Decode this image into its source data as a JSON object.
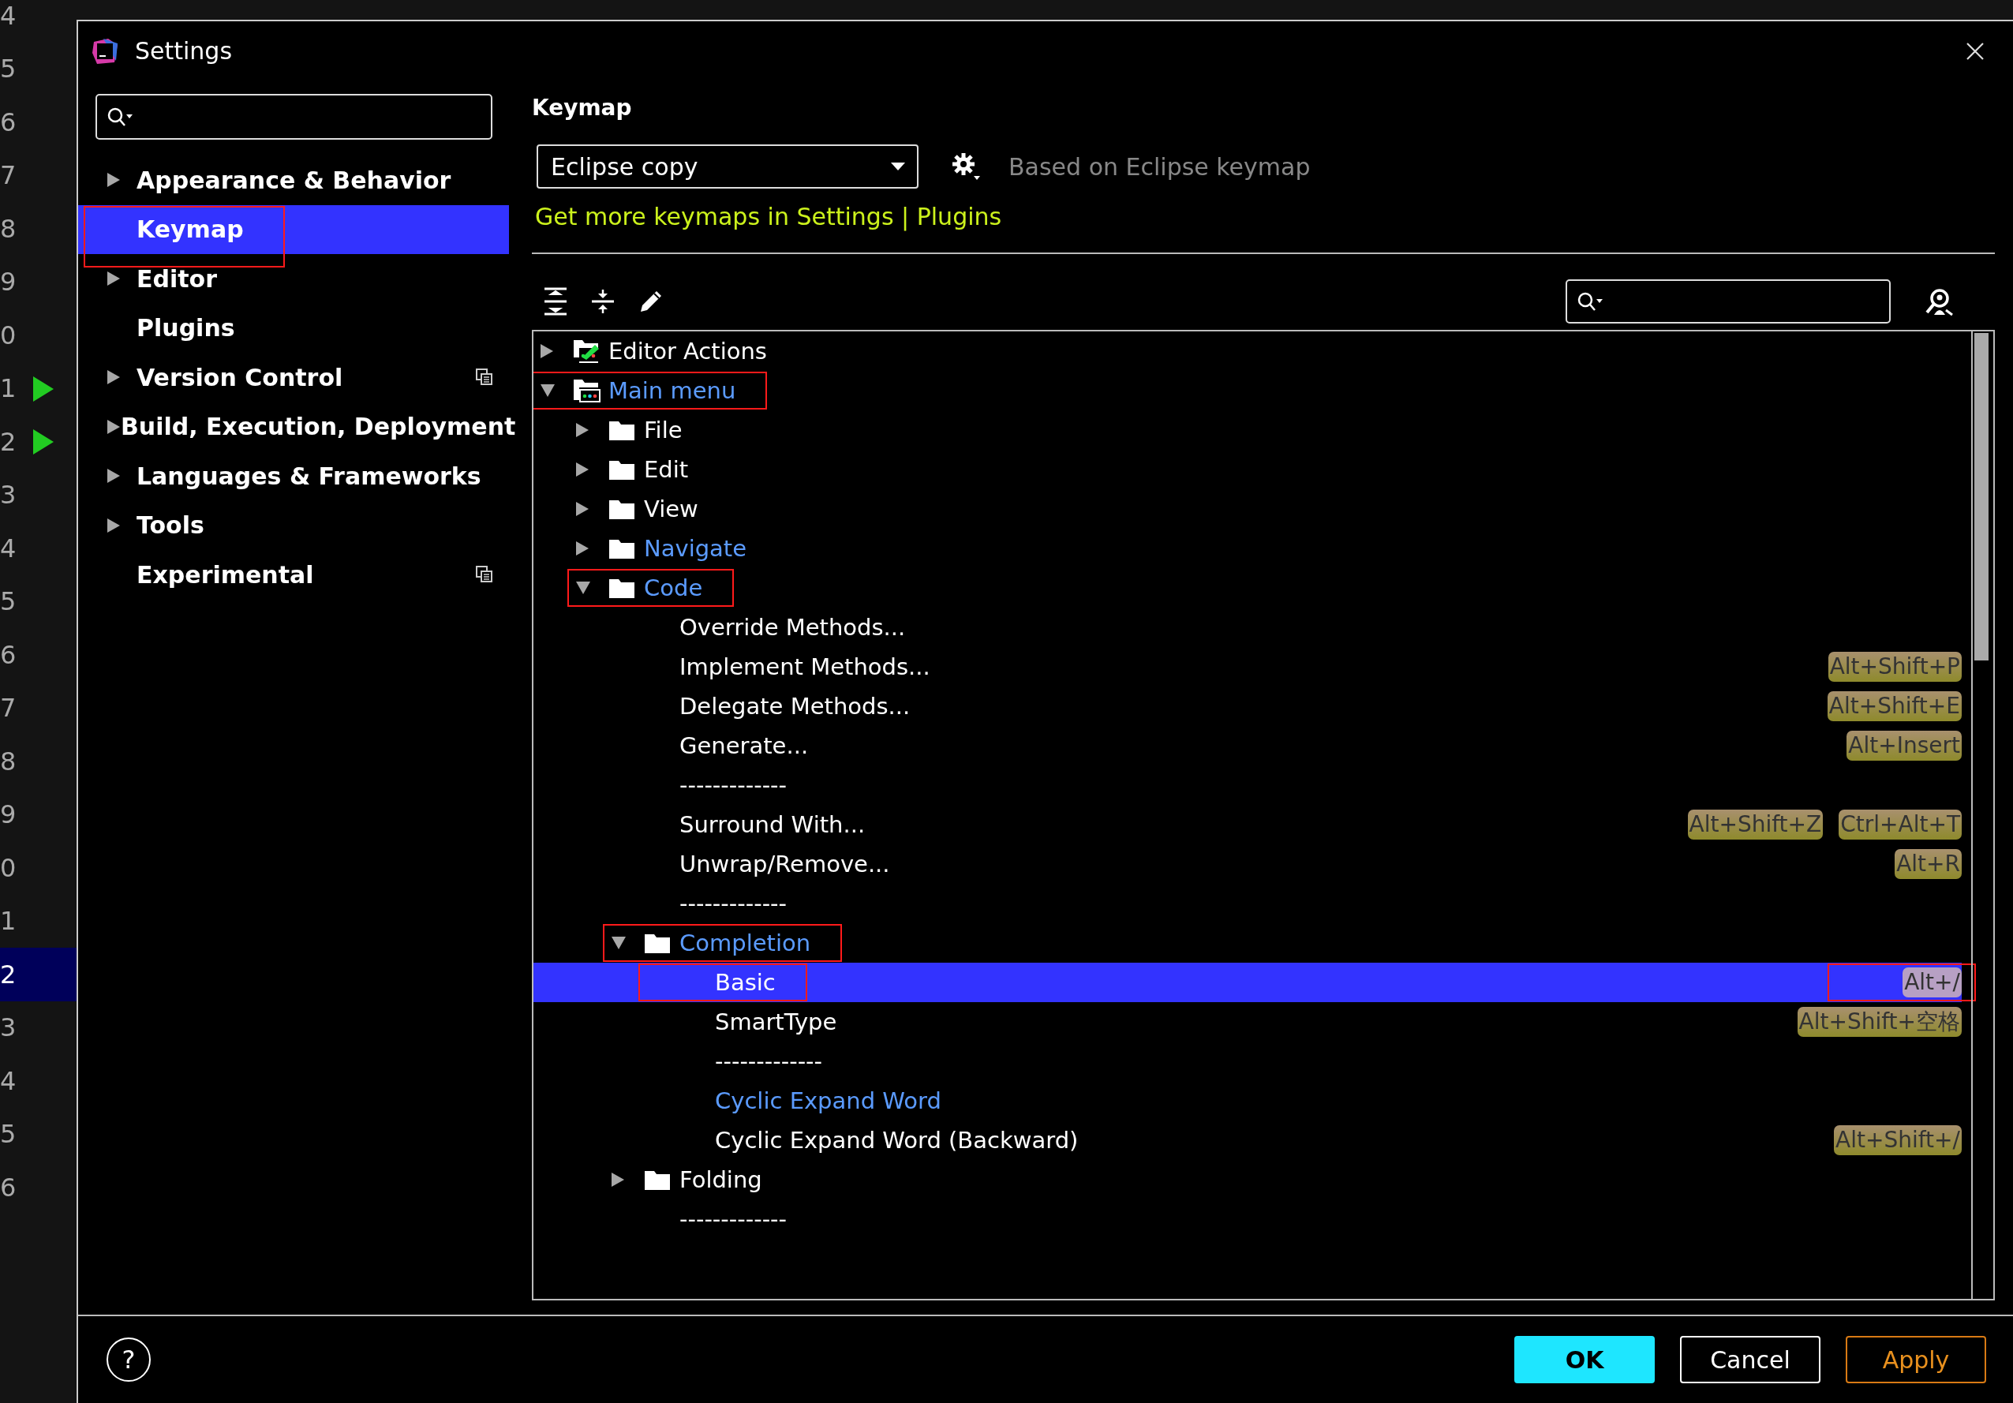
{
  "editor_gutter": {
    "lines": [
      {
        "number": "4",
        "run": false,
        "selected": false
      },
      {
        "number": "5",
        "run": false,
        "selected": false
      },
      {
        "number": "6",
        "run": false,
        "selected": false
      },
      {
        "number": "7",
        "run": false,
        "selected": false
      },
      {
        "number": "8",
        "run": false,
        "selected": false
      },
      {
        "number": "9",
        "run": false,
        "selected": false
      },
      {
        "number": "0",
        "run": false,
        "selected": false
      },
      {
        "number": "1",
        "run": true,
        "selected": false
      },
      {
        "number": "2",
        "run": true,
        "selected": false
      },
      {
        "number": "3",
        "run": false,
        "selected": false
      },
      {
        "number": "4",
        "run": false,
        "selected": false
      },
      {
        "number": "5",
        "run": false,
        "selected": false
      },
      {
        "number": "6",
        "run": false,
        "selected": false
      },
      {
        "number": "7",
        "run": false,
        "selected": false
      },
      {
        "number": "8",
        "run": false,
        "selected": false
      },
      {
        "number": "9",
        "run": false,
        "selected": false
      },
      {
        "number": "0",
        "run": false,
        "selected": false
      },
      {
        "number": "1",
        "run": false,
        "selected": false
      },
      {
        "number": "2",
        "run": false,
        "selected": true
      },
      {
        "number": "3",
        "run": false,
        "selected": false
      },
      {
        "number": "4",
        "run": false,
        "selected": false
      },
      {
        "number": "5",
        "run": false,
        "selected": false
      },
      {
        "number": "6",
        "run": false,
        "selected": false
      }
    ]
  },
  "window": {
    "title": "Settings"
  },
  "sidebar": {
    "items": [
      {
        "label": "Appearance & Behavior",
        "expandable": true,
        "selected": false,
        "marked": false,
        "project_icon": false
      },
      {
        "label": "Keymap",
        "expandable": false,
        "selected": true,
        "marked": true,
        "project_icon": false
      },
      {
        "label": "Editor",
        "expandable": true,
        "selected": false,
        "marked": false,
        "project_icon": false
      },
      {
        "label": "Plugins",
        "expandable": false,
        "selected": false,
        "marked": false,
        "project_icon": false
      },
      {
        "label": "Version Control",
        "expandable": true,
        "selected": false,
        "marked": false,
        "project_icon": true
      },
      {
        "label": "Build, Execution, Deployment",
        "expandable": true,
        "selected": false,
        "marked": false,
        "project_icon": false
      },
      {
        "label": "Languages & Frameworks",
        "expandable": true,
        "selected": false,
        "marked": false,
        "project_icon": false
      },
      {
        "label": "Tools",
        "expandable": true,
        "selected": false,
        "marked": false,
        "project_icon": false
      },
      {
        "label": "Experimental",
        "expandable": false,
        "selected": false,
        "marked": false,
        "project_icon": true
      }
    ]
  },
  "keymap": {
    "heading": "Keymap",
    "scheme": "Eclipse copy",
    "based_on": "Based on Eclipse keymap",
    "link": "Get more keymaps in Settings | Plugins",
    "tree": [
      {
        "label": "Editor Actions",
        "kind": "actions-folder",
        "expanded": false,
        "modified": false,
        "selected": false,
        "marked": false
      },
      {
        "label": "Main menu",
        "kind": "menu-folder",
        "expanded": true,
        "modified": true,
        "selected": false,
        "marked": true,
        "children": [
          {
            "label": "File",
            "kind": "folder",
            "expanded": false,
            "modified": false,
            "selected": false,
            "marked": false
          },
          {
            "label": "Edit",
            "kind": "folder",
            "expanded": false,
            "modified": false,
            "selected": false,
            "marked": false
          },
          {
            "label": "View",
            "kind": "folder",
            "expanded": false,
            "modified": false,
            "selected": false,
            "marked": false
          },
          {
            "label": "Navigate",
            "kind": "folder",
            "expanded": false,
            "modified": true,
            "selected": false,
            "marked": false
          },
          {
            "label": "Code",
            "kind": "folder",
            "expanded": true,
            "modified": true,
            "selected": false,
            "marked": true,
            "children": [
              {
                "label": "Override Methods...",
                "kind": "action",
                "modified": false,
                "selected": false,
                "marked": false
              },
              {
                "label": "Implement Methods...",
                "kind": "action",
                "modified": false,
                "selected": false,
                "marked": false,
                "shortcuts": [
                  {
                    "keys": "Alt+Shift+P",
                    "marked": false
                  }
                ]
              },
              {
                "label": "Delegate Methods...",
                "kind": "action",
                "modified": false,
                "selected": false,
                "marked": false,
                "shortcuts": [
                  {
                    "keys": "Alt+Shift+E",
                    "marked": false
                  }
                ]
              },
              {
                "label": "Generate...",
                "kind": "action",
                "modified": false,
                "selected": false,
                "marked": false,
                "shortcuts": [
                  {
                    "keys": "Alt+Insert",
                    "marked": false
                  }
                ]
              },
              {
                "label": "-------------",
                "kind": "action",
                "modified": false,
                "selected": false,
                "marked": false
              },
              {
                "label": "Surround With...",
                "kind": "action",
                "modified": false,
                "selected": false,
                "marked": false,
                "shortcuts": [
                  {
                    "keys": "Alt+Shift+Z",
                    "marked": false
                  },
                  {
                    "keys": "Ctrl+Alt+T",
                    "marked": false
                  }
                ]
              },
              {
                "label": "Unwrap/Remove...",
                "kind": "action",
                "modified": false,
                "selected": false,
                "marked": false,
                "shortcuts": [
                  {
                    "keys": "Alt+R",
                    "marked": false
                  }
                ]
              },
              {
                "label": "-------------",
                "kind": "action",
                "modified": false,
                "selected": false,
                "marked": false
              },
              {
                "label": "Completion",
                "kind": "folder",
                "expanded": true,
                "modified": true,
                "selected": false,
                "marked": true,
                "children": [
                  {
                    "label": "Basic",
                    "kind": "action",
                    "modified": false,
                    "selected": true,
                    "marked": true,
                    "shortcuts": [
                      {
                        "keys": "Alt+/",
                        "marked": true
                      }
                    ]
                  },
                  {
                    "label": "SmartType",
                    "kind": "action",
                    "modified": false,
                    "selected": false,
                    "marked": false,
                    "shortcuts": [
                      {
                        "keys": "Alt+Shift+空格",
                        "marked": false
                      }
                    ]
                  },
                  {
                    "label": "-------------",
                    "kind": "action",
                    "modified": false,
                    "selected": false,
                    "marked": false
                  },
                  {
                    "label": "Cyclic Expand Word",
                    "kind": "action",
                    "modified": true,
                    "selected": false,
                    "marked": false
                  },
                  {
                    "label": "Cyclic Expand Word (Backward)",
                    "kind": "action",
                    "modified": false,
                    "selected": false,
                    "marked": false,
                    "shortcuts": [
                      {
                        "keys": "Alt+Shift+/",
                        "marked": false
                      }
                    ]
                  }
                ]
              },
              {
                "label": "Folding",
                "kind": "folder",
                "expanded": false,
                "modified": false,
                "selected": false,
                "marked": false
              },
              {
                "label": "-------------",
                "kind": "action",
                "modified": false,
                "selected": false,
                "marked": false
              }
            ]
          }
        ]
      }
    ]
  },
  "footer": {
    "help": "?",
    "buttons": [
      {
        "label": "OK",
        "kind": "primary"
      },
      {
        "label": "Cancel",
        "kind": "normal"
      },
      {
        "label": "Apply",
        "kind": "apply"
      }
    ]
  }
}
